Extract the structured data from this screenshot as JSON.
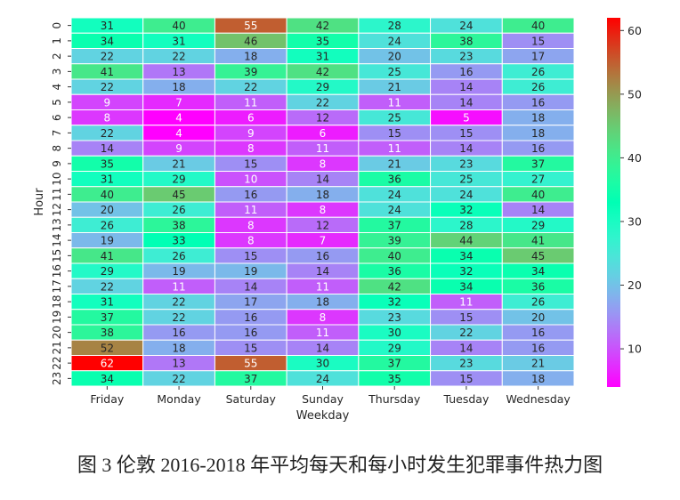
{
  "chart_data": {
    "type": "heatmap",
    "title": "",
    "xlabel": "Weekday",
    "ylabel": "Hour",
    "x_categories": [
      "Friday",
      "Monday",
      "Saturday",
      "Sunday",
      "Thursday",
      "Tuesday",
      "Wednesday"
    ],
    "y_categories": [
      "0",
      "1",
      "2",
      "3",
      "4",
      "5",
      "6",
      "7",
      "8",
      "9",
      "10",
      "11",
      "12",
      "13",
      "14",
      "15",
      "16",
      "17",
      "18",
      "19",
      "20",
      "21",
      "22",
      "23"
    ],
    "values": [
      [
        31,
        40,
        55,
        42,
        28,
        24,
        40
      ],
      [
        34,
        31,
        46,
        35,
        24,
        38,
        15
      ],
      [
        22,
        22,
        18,
        31,
        20,
        23,
        17
      ],
      [
        41,
        13,
        39,
        42,
        25,
        16,
        26
      ],
      [
        22,
        18,
        22,
        29,
        21,
        14,
        26
      ],
      [
        9,
        7,
        11,
        22,
        11,
        14,
        16
      ],
      [
        8,
        4,
        6,
        12,
        25,
        5,
        18
      ],
      [
        22,
        4,
        9,
        6,
        15,
        15,
        18
      ],
      [
        14,
        9,
        8,
        11,
        11,
        14,
        16
      ],
      [
        35,
        21,
        15,
        8,
        21,
        23,
        37
      ],
      [
        31,
        29,
        10,
        14,
        36,
        25,
        27
      ],
      [
        40,
        45,
        16,
        18,
        24,
        24,
        40
      ],
      [
        20,
        26,
        11,
        8,
        24,
        32,
        14
      ],
      [
        26,
        38,
        8,
        12,
        37,
        28,
        29
      ],
      [
        19,
        33,
        8,
        7,
        39,
        44,
        41
      ],
      [
        41,
        26,
        15,
        16,
        40,
        34,
        45
      ],
      [
        29,
        19,
        19,
        14,
        36,
        32,
        34
      ],
      [
        22,
        11,
        14,
        11,
        42,
        34,
        36
      ],
      [
        31,
        22,
        17,
        18,
        32,
        11,
        26
      ],
      [
        37,
        22,
        16,
        8,
        23,
        15,
        20
      ],
      [
        38,
        16,
        16,
        11,
        30,
        22,
        16
      ],
      [
        52,
        18,
        15,
        14,
        29,
        14,
        16
      ],
      [
        62,
        13,
        55,
        30,
        37,
        23,
        21
      ],
      [
        34,
        22,
        37,
        24,
        35,
        15,
        18
      ]
    ],
    "colormap": "rainbow",
    "value_range": [
      4,
      62
    ],
    "annotated": true,
    "colorbar": {
      "ticks": [
        10,
        20,
        30,
        40,
        50,
        60
      ],
      "placement": "right"
    },
    "grid": false
  },
  "caption": "图 3  伦敦 2016-2018 年平均每天和每小时发生犯罪事件热力图"
}
